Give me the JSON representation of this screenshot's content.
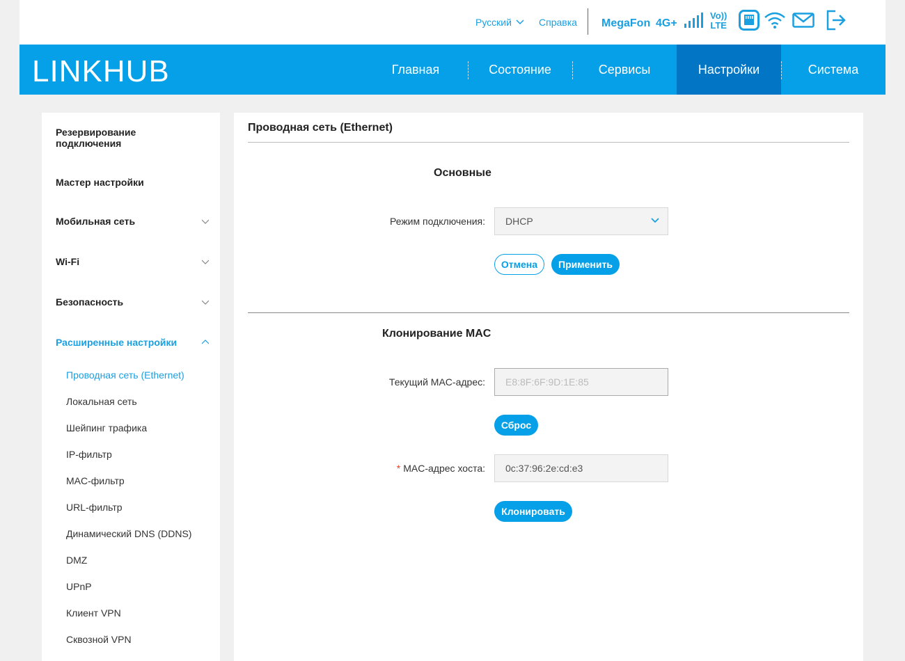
{
  "topbar": {
    "language": "Русский",
    "help": "Справка",
    "operator": "MegaFon",
    "network": "4G+",
    "volte_top": "Vo))",
    "volte_bottom": "LTE"
  },
  "nav": {
    "logo_bold": "LINK",
    "logo_light": "HUB",
    "items": [
      "Главная",
      "Состояние",
      "Сервисы",
      "Настройки",
      "Система"
    ],
    "active": "Настройки"
  },
  "sidebar": {
    "items": [
      "Резервирование подключения",
      "Мастер настройки",
      "Мобильная сеть",
      "Wi-Fi",
      "Безопасность",
      "Расширенные настройки"
    ],
    "subitems": [
      "Проводная сеть (Ethernet)",
      "Локальная сеть",
      "Шейпинг трафика",
      "IP-фильтр",
      "MAC-фильтр",
      "URL-фильтр",
      "Динамический DNS (DDNS)",
      "DMZ",
      "UPnP",
      "Клиент VPN",
      "Сквозной VPN"
    ]
  },
  "main": {
    "title": "Проводная сеть (Ethernet)",
    "basic": {
      "heading": "Основные",
      "mode_label": "Режим подключения:",
      "mode_value": "DHCP",
      "cancel": "Отмена",
      "apply": "Применить"
    },
    "mac": {
      "heading": "Клонирование MAC",
      "current_label": "Текущий MAC-адрес:",
      "current_value": "E8:8F:6F:9D:1E:85",
      "reset": "Сброс",
      "required_mark": "*",
      "host_label": "MAC-адрес хоста:",
      "host_value": "0c:37:96:2e:cd:e3",
      "clone": "Клонировать"
    }
  },
  "colors": {
    "accent": "#05a0e8",
    "nav_active": "#0276c5",
    "required": "#e0442b"
  }
}
